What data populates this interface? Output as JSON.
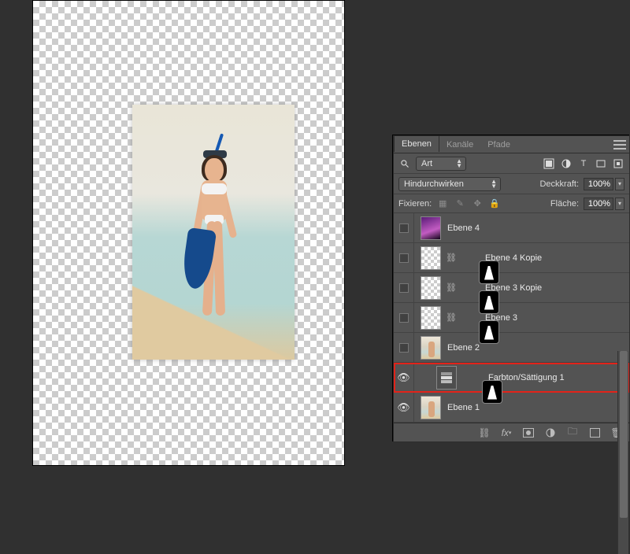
{
  "panel": {
    "tabs": {
      "layers": "Ebenen",
      "channels": "Kanäle",
      "paths": "Pfade"
    },
    "filter_mode": "Art",
    "blend_mode": "Hindurchwirken",
    "opacity_label": "Deckkraft:",
    "opacity_value": "100%",
    "lock_label": "Fixieren:",
    "fill_label": "Fläche:",
    "fill_value": "100%"
  },
  "layers": [
    {
      "name": "Ebene 4"
    },
    {
      "name": "Ebene 4 Kopie"
    },
    {
      "name": "Ebene 3 Kopie"
    },
    {
      "name": "Ebene 3"
    },
    {
      "name": "Ebene 2"
    },
    {
      "name": "Farbton/Sättigung 1"
    },
    {
      "name": "Ebene 1"
    }
  ]
}
